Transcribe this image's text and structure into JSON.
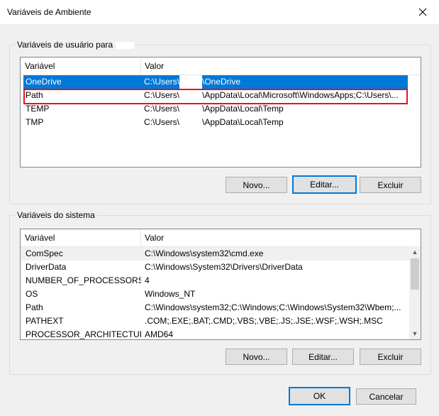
{
  "window": {
    "title": "Variáveis de Ambiente",
    "close_icon": "close-icon"
  },
  "user_group": {
    "label": "Variáveis de usuário para",
    "headers": [
      "Variável",
      "Valor"
    ],
    "rows": [
      {
        "variable": "OneDrive",
        "value_prefix": "C:\\Users\\",
        "value_suffix": "\\OneDrive",
        "selected": true
      },
      {
        "variable": "Path",
        "value_prefix": "C:\\Users\\",
        "value_suffix": "\\AppData\\Local\\Microsoft\\WindowsApps;C:\\Users\\...",
        "highlighted": true
      },
      {
        "variable": "TEMP",
        "value_prefix": "C:\\Users\\",
        "value_suffix": "\\AppData\\Local\\Temp"
      },
      {
        "variable": "TMP",
        "value_prefix": "C:\\Users\\",
        "value_suffix": "\\AppData\\Local\\Temp"
      }
    ],
    "buttons": {
      "new": "Novo...",
      "edit": "Editar...",
      "delete": "Excluir"
    }
  },
  "system_group": {
    "label": "Variáveis do sistema",
    "headers": [
      "Variável",
      "Valor"
    ],
    "rows": [
      {
        "variable": "ComSpec",
        "value": "C:\\Windows\\system32\\cmd.exe"
      },
      {
        "variable": "DriverData",
        "value": "C:\\Windows\\System32\\Drivers\\DriverData"
      },
      {
        "variable": "NUMBER_OF_PROCESSORS",
        "value": "4"
      },
      {
        "variable": "OS",
        "value": "Windows_NT"
      },
      {
        "variable": "Path",
        "value": "C:\\Windows\\system32;C:\\Windows;C:\\Windows\\System32\\Wbem;..."
      },
      {
        "variable": "PATHEXT",
        "value": ".COM;.EXE;.BAT;.CMD;.VBS;.VBE;.JS;.JSE;.WSF;.WSH;.MSC"
      },
      {
        "variable": "PROCESSOR_ARCHITECTURE",
        "value": "AMD64"
      }
    ],
    "buttons": {
      "new": "Novo...",
      "edit": "Editar...",
      "delete": "Excluir"
    }
  },
  "footer": {
    "ok": "OK",
    "cancel": "Cancelar"
  },
  "colors": {
    "selection": "#0078d7",
    "highlight_border": "#e81123",
    "default_button_border": "#0078d7"
  }
}
